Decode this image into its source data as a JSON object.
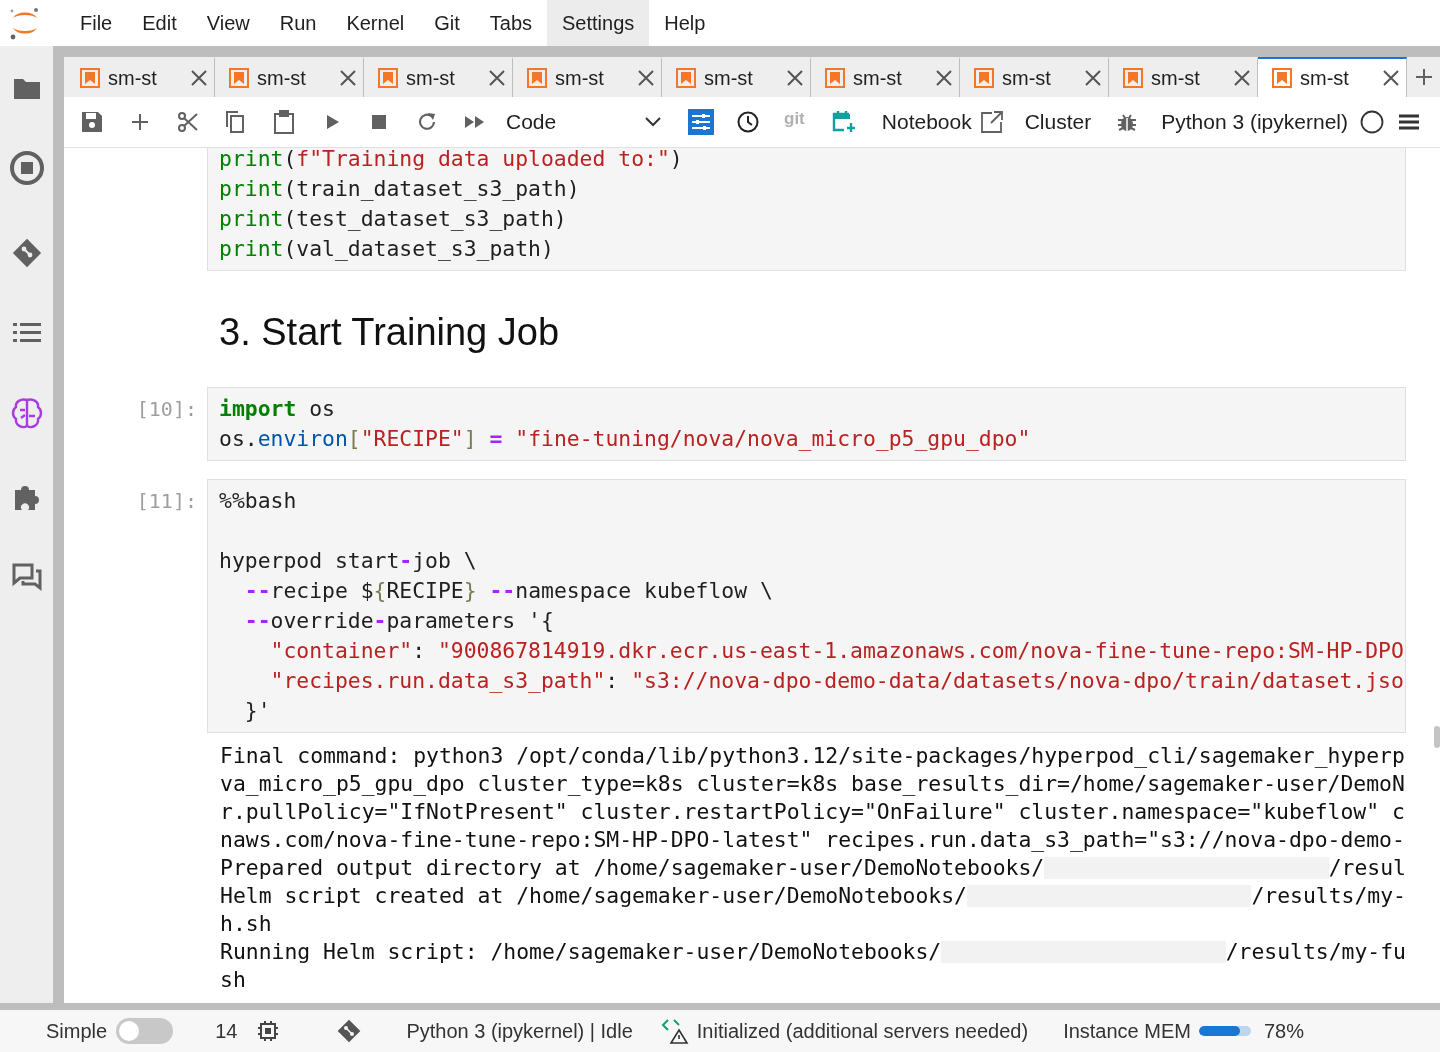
{
  "menu": [
    {
      "label": "File",
      "selected": false
    },
    {
      "label": "Edit",
      "selected": false
    },
    {
      "label": "View",
      "selected": false
    },
    {
      "label": "Run",
      "selected": false
    },
    {
      "label": "Kernel",
      "selected": false
    },
    {
      "label": "Git",
      "selected": false
    },
    {
      "label": "Tabs",
      "selected": false
    },
    {
      "label": "Settings",
      "selected": true
    },
    {
      "label": "Help",
      "selected": false
    }
  ],
  "tabs": [
    {
      "label": "sm-st",
      "selected": false
    },
    {
      "label": "sm-st",
      "selected": false
    },
    {
      "label": "sm-st",
      "selected": false
    },
    {
      "label": "sm-st",
      "selected": false
    },
    {
      "label": "sm-st",
      "selected": false
    },
    {
      "label": "sm-st",
      "selected": false
    },
    {
      "label": "sm-st",
      "selected": false
    },
    {
      "label": "sm-st",
      "selected": false
    },
    {
      "label": "sm-st",
      "selected": true
    }
  ],
  "toolbar": {
    "cell_type": "Code",
    "git_label": "git",
    "notebook_label": "Notebook",
    "cluster_label": "Cluster",
    "kernel": "Python 3 (ipykernel)"
  },
  "cells": [
    {
      "kind": "code",
      "lines": [
        {
          "kind": "code",
          "segments": [
            {
              "kind": "builtin",
              "text": "print"
            },
            {
              "kind": "plain",
              "text": "("
            },
            {
              "kind": "str",
              "text": "f\"Training data uploaded to:\""
            },
            {
              "kind": "plain",
              "text": ")"
            }
          ]
        },
        {
          "kind": "code",
          "segments": [
            {
              "kind": "builtin",
              "text": "print"
            },
            {
              "kind": "plain",
              "text": "(train_dataset_s3_path)"
            }
          ]
        },
        {
          "kind": "code",
          "segments": [
            {
              "kind": "builtin",
              "text": "print"
            },
            {
              "kind": "plain",
              "text": "(test_dataset_s3_path)"
            }
          ]
        },
        {
          "kind": "code",
          "segments": [
            {
              "kind": "builtin",
              "text": "print"
            },
            {
              "kind": "plain",
              "text": "(val_dataset_s3_path)"
            }
          ]
        }
      ]
    },
    {
      "kind": "markdown",
      "heading": "3. Start Training Job"
    },
    {
      "kind": "code",
      "prompt": "[10]:",
      "lines": [
        {
          "kind": "code",
          "segments": [
            {
              "kind": "kw",
              "text": "import"
            },
            {
              "kind": "plain",
              "text": " os"
            }
          ]
        },
        {
          "kind": "code",
          "segments": [
            {
              "kind": "plain",
              "text": "os."
            },
            {
              "kind": "var",
              "text": "environ"
            },
            {
              "kind": "brace",
              "text": "["
            },
            {
              "kind": "str",
              "text": "\"RECIPE\""
            },
            {
              "kind": "brace",
              "text": "] "
            },
            {
              "kind": "op",
              "text": "= "
            },
            {
              "kind": "str",
              "text": "\"fine-tuning/nova/nova_micro_p5_gpu_dpo\""
            }
          ]
        }
      ]
    },
    {
      "kind": "code",
      "prompt": "[11]:",
      "lines": [
        {
          "kind": "code",
          "segments": [
            {
              "kind": "plain",
              "text": "%%bash"
            }
          ]
        },
        {
          "kind": "blank"
        },
        {
          "kind": "code",
          "segments": [
            {
              "kind": "plain",
              "text": "hyperpod start"
            },
            {
              "kind": "op",
              "text": "-"
            },
            {
              "kind": "plain",
              "text": "job \\"
            }
          ]
        },
        {
          "kind": "code",
          "segments": [
            {
              "kind": "op",
              "text": "  --"
            },
            {
              "kind": "plain",
              "text": "recipe $"
            },
            {
              "kind": "brace",
              "text": "{"
            },
            {
              "kind": "plain",
              "text": "RECIPE"
            },
            {
              "kind": "brace",
              "text": "} "
            },
            {
              "kind": "op",
              "text": "--"
            },
            {
              "kind": "plain",
              "text": "namespace kubeflow \\"
            }
          ]
        },
        {
          "kind": "code",
          "segments": [
            {
              "kind": "op",
              "text": "  --"
            },
            {
              "kind": "plain",
              "text": "override"
            },
            {
              "kind": "op",
              "text": "-"
            },
            {
              "kind": "plain",
              "text": "parameters '{"
            }
          ]
        },
        {
          "kind": "code",
          "segments": [
            {
              "kind": "str",
              "text": "    \"container\""
            },
            {
              "kind": "plain",
              "text": ": "
            },
            {
              "kind": "str",
              "text": "\"900867814919.dkr.ecr.us-east-1.amazonaws.com/nova-fine-tune-repo:SM-HP-DPO"
            }
          ]
        },
        {
          "kind": "code",
          "segments": [
            {
              "kind": "str",
              "text": "    \"recipes.run.data_s3_path\""
            },
            {
              "kind": "plain",
              "text": ": "
            },
            {
              "kind": "str",
              "text": "\"s3://nova-dpo-demo-data/datasets/nova-dpo/train/dataset.jso"
            }
          ]
        },
        {
          "kind": "code",
          "segments": [
            {
              "kind": "plain",
              "text": "  }'"
            }
          ]
        }
      ],
      "output": [
        {
          "parts": [
            {
              "kind": "text",
              "text": "Final command: python3 /opt/conda/lib/python3.12/site-packages/hyperpod_cli/sagemaker_hyperp"
            }
          ]
        },
        {
          "parts": [
            {
              "kind": "text",
              "text": "va_micro_p5_gpu_dpo cluster_type=k8s cluster=k8s base_results_dir=/home/sagemaker-user/DemoN"
            }
          ]
        },
        {
          "parts": [
            {
              "kind": "text",
              "text": "r.pullPolicy=\"IfNotPresent\" cluster.restartPolicy=\"OnFailure\" cluster.namespace=\"kubeflow\" c"
            }
          ]
        },
        {
          "parts": [
            {
              "kind": "text",
              "text": "naws.com/nova-fine-tune-repo:SM-HP-DPO-latest\" recipes.run.data_s3_path=\"s3://nova-dpo-demo-"
            }
          ]
        },
        {
          "parts": [
            {
              "kind": "text",
              "text": "Prepared output directory at /home/sagemaker-user/DemoNotebooks/"
            },
            {
              "kind": "redacted"
            },
            {
              "kind": "text",
              "text": "/resul"
            }
          ]
        },
        {
          "parts": [
            {
              "kind": "text",
              "text": "Helm script created at /home/sagemaker-user/DemoNotebooks/"
            },
            {
              "kind": "redacted"
            },
            {
              "kind": "text",
              "text": "/results/my-"
            }
          ]
        },
        {
          "parts": [
            {
              "kind": "text",
              "text": "h.sh"
            }
          ]
        },
        {
          "parts": [
            {
              "kind": "text",
              "text": "Running Helm script: /home/sagemaker-user/DemoNotebooks/"
            },
            {
              "kind": "redacted"
            },
            {
              "kind": "text",
              "text": "/results/my-fu"
            }
          ]
        },
        {
          "parts": [
            {
              "kind": "text",
              "text": "sh"
            }
          ]
        }
      ]
    }
  ],
  "status_bar": {
    "mode_label": "Simple",
    "simple_mode": false,
    "count": "14",
    "kernel_status": "Python 3 (ipykernel) | Idle",
    "server_status": "Initialized (additional servers needed)",
    "mem_label": "Instance MEM",
    "mem": {
      "level": 0.78
    },
    "mem_reading": "78%"
  }
}
